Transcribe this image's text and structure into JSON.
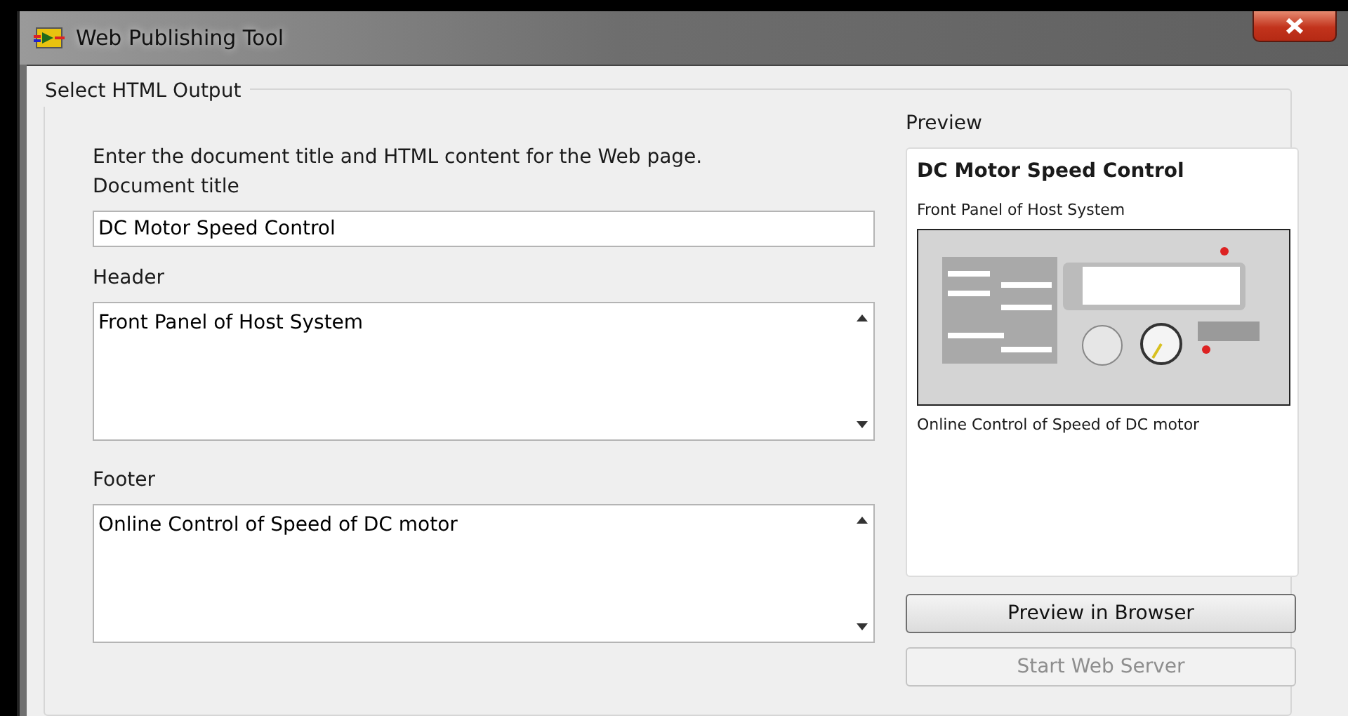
{
  "window": {
    "title": "Web Publishing Tool"
  },
  "group": {
    "title": "Select HTML Output"
  },
  "instructions": "Enter the document title and HTML content for the Web page.",
  "fields": [
    {
      "kind": "line",
      "label": "Document title",
      "value": "DC Motor Speed Control"
    },
    {
      "kind": "area",
      "label": "Header",
      "value": "Front Panel of Host System"
    },
    {
      "kind": "area",
      "label": "Footer",
      "value": "Online Control of Speed of DC motor"
    }
  ],
  "preview": {
    "label": "Preview",
    "title": "DC Motor Speed Control",
    "header": "Front Panel of Host System",
    "footer": "Online Control of Speed of DC motor"
  },
  "buttons": [
    {
      "label": "Preview in Browser",
      "disabled": false
    },
    {
      "label": "Start Web Server",
      "disabled": true
    }
  ]
}
